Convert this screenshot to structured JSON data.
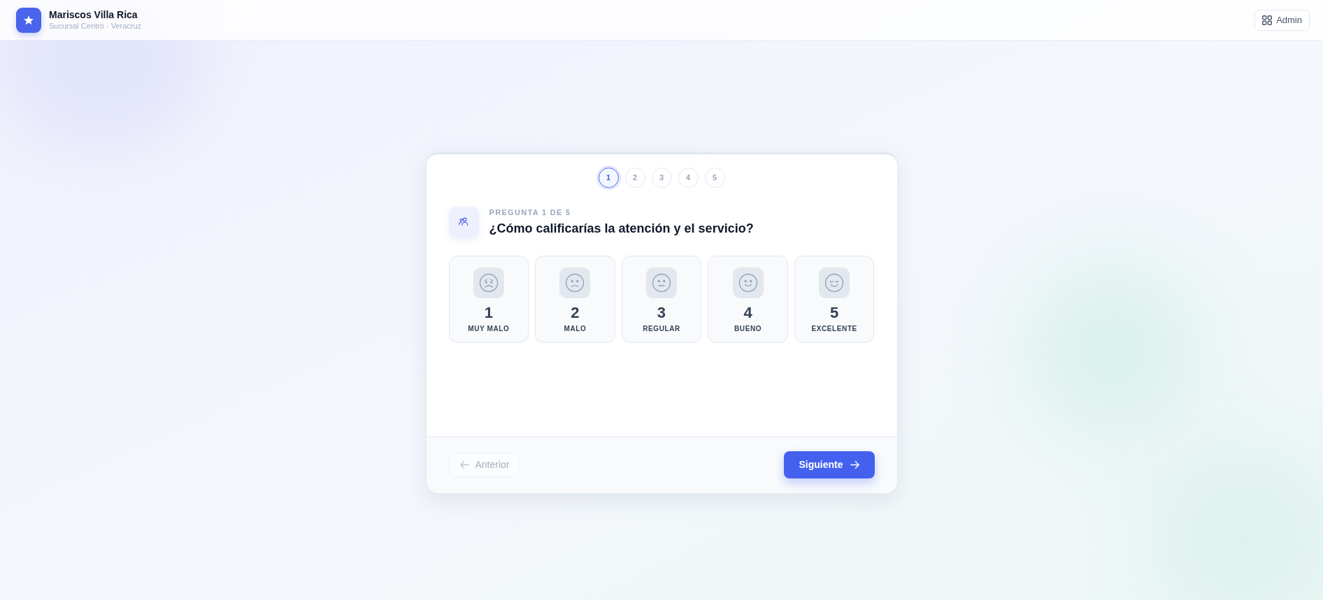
{
  "header": {
    "title": "Mariscos Villa Rica",
    "subtitle": "Sucursal Centro · Veracruz",
    "admin_button": "Admin"
  },
  "survey": {
    "steps": [
      {
        "label": "1",
        "selected": true
      },
      {
        "label": "2",
        "selected": false
      },
      {
        "label": "3",
        "selected": false
      },
      {
        "label": "4",
        "selected": false
      },
      {
        "label": "5",
        "selected": false
      }
    ],
    "question": {
      "eyebrow": "PREGUNTA 1 DE 5",
      "text": "¿Cómo calificarías la atención y el servicio?"
    },
    "options": [
      {
        "kind": "worried",
        "number": "1",
        "label": "MUY MALO",
        "selected": false
      },
      {
        "kind": "sad",
        "number": "2",
        "label": "MALO",
        "selected": false
      },
      {
        "kind": "neutral",
        "number": "3",
        "label": "REGULAR",
        "selected": false
      },
      {
        "kind": "smile",
        "number": "4",
        "label": "BUENO",
        "selected": false
      },
      {
        "kind": "joy",
        "number": "5",
        "label": "EXCELENTE",
        "selected": false
      }
    ],
    "buttons": [
      {
        "kind": "back",
        "label": "Anterior",
        "disabled": true
      },
      {
        "kind": "next",
        "label": "Siguiente",
        "disabled": false
      }
    ]
  }
}
